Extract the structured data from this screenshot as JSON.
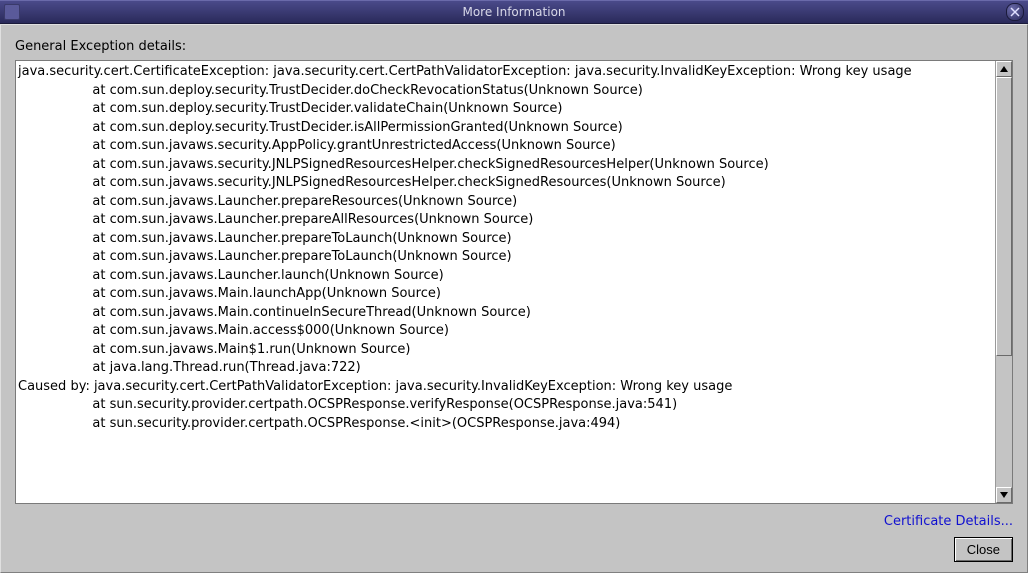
{
  "window": {
    "title": "More Information"
  },
  "section_label": "General Exception details:",
  "exception_text": "java.security.cert.CertificateException: java.security.cert.CertPathValidatorException: java.security.InvalidKeyException: Wrong key usage\n                  at com.sun.deploy.security.TrustDecider.doCheckRevocationStatus(Unknown Source)\n                  at com.sun.deploy.security.TrustDecider.validateChain(Unknown Source)\n                  at com.sun.deploy.security.TrustDecider.isAllPermissionGranted(Unknown Source)\n                  at com.sun.javaws.security.AppPolicy.grantUnrestrictedAccess(Unknown Source)\n                  at com.sun.javaws.security.JNLPSignedResourcesHelper.checkSignedResourcesHelper(Unknown Source)\n                  at com.sun.javaws.security.JNLPSignedResourcesHelper.checkSignedResources(Unknown Source)\n                  at com.sun.javaws.Launcher.prepareResources(Unknown Source)\n                  at com.sun.javaws.Launcher.prepareAllResources(Unknown Source)\n                  at com.sun.javaws.Launcher.prepareToLaunch(Unknown Source)\n                  at com.sun.javaws.Launcher.prepareToLaunch(Unknown Source)\n                  at com.sun.javaws.Launcher.launch(Unknown Source)\n                  at com.sun.javaws.Main.launchApp(Unknown Source)\n                  at com.sun.javaws.Main.continueInSecureThread(Unknown Source)\n                  at com.sun.javaws.Main.access$000(Unknown Source)\n                  at com.sun.javaws.Main$1.run(Unknown Source)\n                  at java.lang.Thread.run(Thread.java:722)\nCaused by: java.security.cert.CertPathValidatorException: java.security.InvalidKeyException: Wrong key usage\n                  at sun.security.provider.certpath.OCSPResponse.verifyResponse(OCSPResponse.java:541)\n                  at sun.security.provider.certpath.OCSPResponse.<init>(OCSPResponse.java:494)",
  "link_label": "Certificate Details...",
  "close_label": "Close"
}
